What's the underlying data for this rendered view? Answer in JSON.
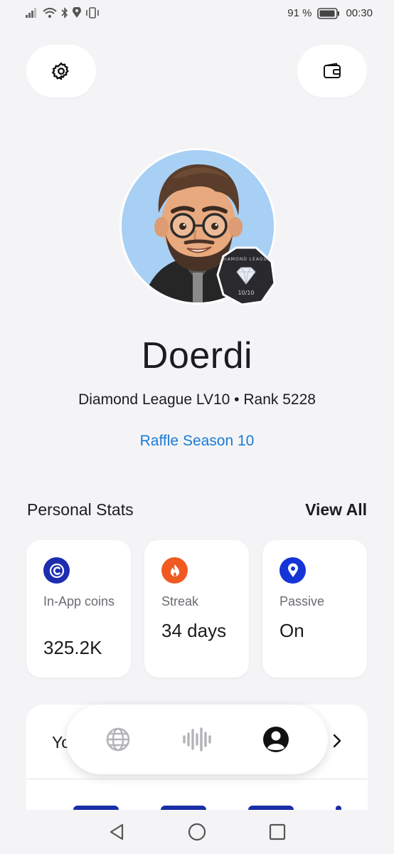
{
  "status": {
    "battery_percent": "91 %",
    "time": "00:30"
  },
  "profile": {
    "username": "Doerdi",
    "subtitle": "Diamond League LV10 • Rank 5228",
    "season_link": "Raffle Season 10",
    "badge": {
      "title": "DIAMOND LEAGUE",
      "level": "10/10"
    }
  },
  "stats": {
    "title": "Personal Stats",
    "view_all": "View All",
    "cards": [
      {
        "icon": "coin-icon",
        "label": "In-App coins",
        "value": "325.2K",
        "color": "#1d2db0"
      },
      {
        "icon": "flame-icon",
        "label": "Streak",
        "value": "34 days",
        "color": "#f05a22"
      },
      {
        "icon": "location-pin-icon",
        "label": "Passive",
        "value": "On",
        "color": "#1535d6"
      }
    ]
  },
  "bottom_card": {
    "prefix": "Yo"
  },
  "nav": {
    "items": [
      "globe-icon",
      "soundwave-icon",
      "profile-icon"
    ]
  },
  "colors": {
    "accent_link": "#1a7ad6",
    "background": "#f4f4f6"
  }
}
